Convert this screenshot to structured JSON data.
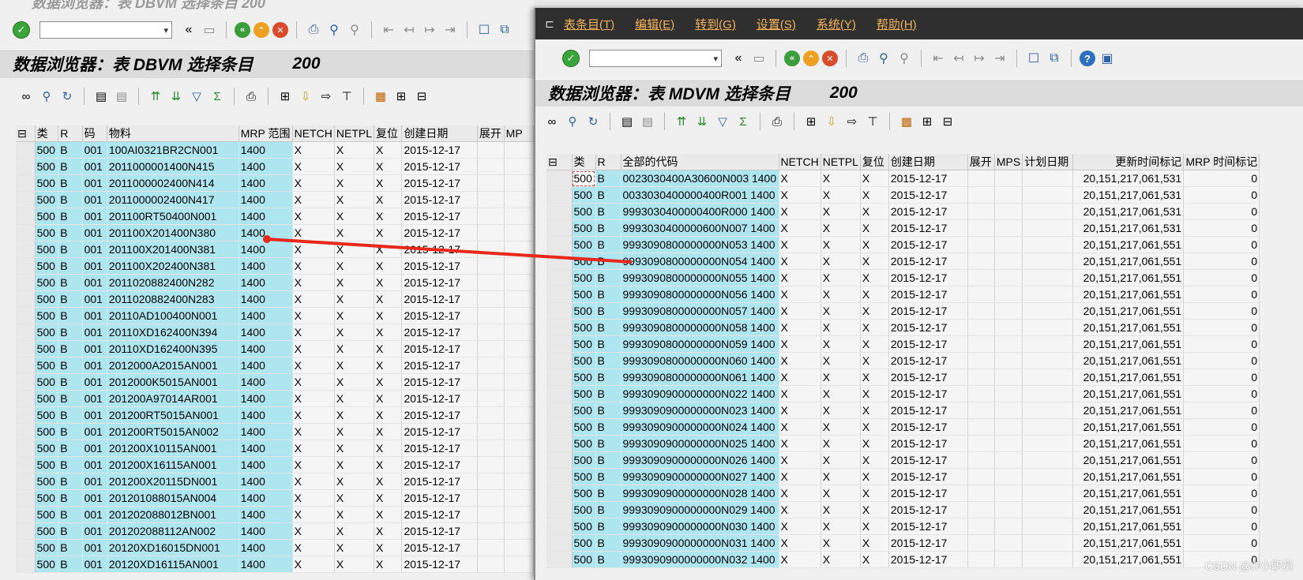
{
  "left": {
    "ghost_title": "数据浏览器：表 DBVM 选择条目     200",
    "title": "数据浏览器：表 DBVM 选择条目",
    "count": "200",
    "columns": [
      "类",
      "R",
      "码",
      "物料",
      "MRP 范围",
      "NETCH",
      "NETPL",
      "复位",
      "创建日期",
      "展开",
      "MP"
    ],
    "rows": [
      [
        "500",
        "B",
        "001",
        "100AI0321BR2CN001",
        "1400",
        "X",
        "X",
        "X",
        "2015-12-17"
      ],
      [
        "500",
        "B",
        "001",
        "2011000001400N415",
        "1400",
        "X",
        "X",
        "X",
        "2015-12-17"
      ],
      [
        "500",
        "B",
        "001",
        "2011000002400N414",
        "1400",
        "X",
        "X",
        "X",
        "2015-12-17"
      ],
      [
        "500",
        "B",
        "001",
        "2011000002400N417",
        "1400",
        "X",
        "X",
        "X",
        "2015-12-17"
      ],
      [
        "500",
        "B",
        "001",
        "201100RT50400N001",
        "1400",
        "X",
        "X",
        "X",
        "2015-12-17"
      ],
      [
        "500",
        "B",
        "001",
        "201100X201400N380",
        "1400",
        "X",
        "X",
        "X",
        "2015-12-17"
      ],
      [
        "500",
        "B",
        "001",
        "201100X201400N381",
        "1400",
        "X",
        "X",
        "X",
        "2015-12-17"
      ],
      [
        "500",
        "B",
        "001",
        "201100X202400N381",
        "1400",
        "X",
        "X",
        "X",
        "2015-12-17"
      ],
      [
        "500",
        "B",
        "001",
        "2011020882400N282",
        "1400",
        "X",
        "X",
        "X",
        "2015-12-17"
      ],
      [
        "500",
        "B",
        "001",
        "2011020882400N283",
        "1400",
        "X",
        "X",
        "X",
        "2015-12-17"
      ],
      [
        "500",
        "B",
        "001",
        "20110AD100400N001",
        "1400",
        "X",
        "X",
        "X",
        "2015-12-17"
      ],
      [
        "500",
        "B",
        "001",
        "20110XD162400N394",
        "1400",
        "X",
        "X",
        "X",
        "2015-12-17"
      ],
      [
        "500",
        "B",
        "001",
        "20110XD162400N395",
        "1400",
        "X",
        "X",
        "X",
        "2015-12-17"
      ],
      [
        "500",
        "B",
        "001",
        "2012000A2015AN001",
        "1400",
        "X",
        "X",
        "X",
        "2015-12-17"
      ],
      [
        "500",
        "B",
        "001",
        "2012000K5015AN001",
        "1400",
        "X",
        "X",
        "X",
        "2015-12-17"
      ],
      [
        "500",
        "B",
        "001",
        "201200A97014AR001",
        "1400",
        "X",
        "X",
        "X",
        "2015-12-17"
      ],
      [
        "500",
        "B",
        "001",
        "201200RT5015AN001",
        "1400",
        "X",
        "X",
        "X",
        "2015-12-17"
      ],
      [
        "500",
        "B",
        "001",
        "201200RT5015AN002",
        "1400",
        "X",
        "X",
        "X",
        "2015-12-17"
      ],
      [
        "500",
        "B",
        "001",
        "201200X10115AN001",
        "1400",
        "X",
        "X",
        "X",
        "2015-12-17"
      ],
      [
        "500",
        "B",
        "001",
        "201200X16115AN001",
        "1400",
        "X",
        "X",
        "X",
        "2015-12-17"
      ],
      [
        "500",
        "B",
        "001",
        "201200X20115DN001",
        "1400",
        "X",
        "X",
        "X",
        "2015-12-17"
      ],
      [
        "500",
        "B",
        "001",
        "201201088015AN004",
        "1400",
        "X",
        "X",
        "X",
        "2015-12-17"
      ],
      [
        "500",
        "B",
        "001",
        "201202088012BN001",
        "1400",
        "X",
        "X",
        "X",
        "2015-12-17"
      ],
      [
        "500",
        "B",
        "001",
        "201202088112AN002",
        "1400",
        "X",
        "X",
        "X",
        "2015-12-17"
      ],
      [
        "500",
        "B",
        "001",
        "20120XD16015DN001",
        "1400",
        "X",
        "X",
        "X",
        "2015-12-17"
      ],
      [
        "500",
        "B",
        "001",
        "20120XD16115AN001",
        "1400",
        "X",
        "X",
        "X",
        "2015-12-17"
      ]
    ]
  },
  "right": {
    "menu": [
      "表条目(T)",
      "编辑(E)",
      "转到(G)",
      "设置(S)",
      "系统(Y)",
      "帮助(H)"
    ],
    "title": "数据浏览器：表 MDVM 选择条目",
    "count": "200",
    "columns": [
      "类",
      "R",
      "全部的代码",
      "NETCH",
      "NETPL",
      "复位",
      "创建日期",
      "展开",
      "MPS",
      "计划日期",
      "更新时间标记",
      "MRP 时间标记"
    ],
    "rows": [
      [
        "500",
        "B",
        "0023030400A30600N003 1400",
        "X",
        "X",
        "X",
        "2015-12-17",
        "",
        "",
        "",
        "20,151,217,061,531",
        "0"
      ],
      [
        "500",
        "B",
        "0033030400000400R001 1400",
        "X",
        "X",
        "X",
        "2015-12-17",
        "",
        "",
        "",
        "20,151,217,061,531",
        "0"
      ],
      [
        "500",
        "B",
        "9993030400000400R000 1400",
        "X",
        "X",
        "X",
        "2015-12-17",
        "",
        "",
        "",
        "20,151,217,061,531",
        "0"
      ],
      [
        "500",
        "B",
        "9993030400000600N007 1400",
        "X",
        "X",
        "X",
        "2015-12-17",
        "",
        "",
        "",
        "20,151,217,061,531",
        "0"
      ],
      [
        "500",
        "B",
        "9993090800000000N053 1400",
        "X",
        "X",
        "X",
        "2015-12-17",
        "",
        "",
        "",
        "20,151,217,061,551",
        "0"
      ],
      [
        "500",
        "B",
        "9993090800000000N054 1400",
        "X",
        "X",
        "X",
        "2015-12-17",
        "",
        "",
        "",
        "20,151,217,061,551",
        "0"
      ],
      [
        "500",
        "B",
        "9993090800000000N055 1400",
        "X",
        "X",
        "X",
        "2015-12-17",
        "",
        "",
        "",
        "20,151,217,061,551",
        "0"
      ],
      [
        "500",
        "B",
        "9993090800000000N056 1400",
        "X",
        "X",
        "X",
        "2015-12-17",
        "",
        "",
        "",
        "20,151,217,061,551",
        "0"
      ],
      [
        "500",
        "B",
        "9993090800000000N057 1400",
        "X",
        "X",
        "X",
        "2015-12-17",
        "",
        "",
        "",
        "20,151,217,061,551",
        "0"
      ],
      [
        "500",
        "B",
        "9993090800000000N058 1400",
        "X",
        "X",
        "X",
        "2015-12-17",
        "",
        "",
        "",
        "20,151,217,061,551",
        "0"
      ],
      [
        "500",
        "B",
        "9993090800000000N059 1400",
        "X",
        "X",
        "X",
        "2015-12-17",
        "",
        "",
        "",
        "20,151,217,061,551",
        "0"
      ],
      [
        "500",
        "B",
        "9993090800000000N060 1400",
        "X",
        "X",
        "X",
        "2015-12-17",
        "",
        "",
        "",
        "20,151,217,061,551",
        "0"
      ],
      [
        "500",
        "B",
        "9993090800000000N061 1400",
        "X",
        "X",
        "X",
        "2015-12-17",
        "",
        "",
        "",
        "20,151,217,061,551",
        "0"
      ],
      [
        "500",
        "B",
        "9993090900000000N022 1400",
        "X",
        "X",
        "X",
        "2015-12-17",
        "",
        "",
        "",
        "20,151,217,061,551",
        "0"
      ],
      [
        "500",
        "B",
        "9993090900000000N023 1400",
        "X",
        "X",
        "X",
        "2015-12-17",
        "",
        "",
        "",
        "20,151,217,061,551",
        "0"
      ],
      [
        "500",
        "B",
        "9993090900000000N024 1400",
        "X",
        "X",
        "X",
        "2015-12-17",
        "",
        "",
        "",
        "20,151,217,061,551",
        "0"
      ],
      [
        "500",
        "B",
        "9993090900000000N025 1400",
        "X",
        "X",
        "X",
        "2015-12-17",
        "",
        "",
        "",
        "20,151,217,061,551",
        "0"
      ],
      [
        "500",
        "B",
        "9993090900000000N026 1400",
        "X",
        "X",
        "X",
        "2015-12-17",
        "",
        "",
        "",
        "20,151,217,061,551",
        "0"
      ],
      [
        "500",
        "B",
        "9993090900000000N027 1400",
        "X",
        "X",
        "X",
        "2015-12-17",
        "",
        "",
        "",
        "20,151,217,061,551",
        "0"
      ],
      [
        "500",
        "B",
        "9993090900000000N028 1400",
        "X",
        "X",
        "X",
        "2015-12-17",
        "",
        "",
        "",
        "20,151,217,061,551",
        "0"
      ],
      [
        "500",
        "B",
        "9993090900000000N029 1400",
        "X",
        "X",
        "X",
        "2015-12-17",
        "",
        "",
        "",
        "20,151,217,061,551",
        "0"
      ],
      [
        "500",
        "B",
        "9993090900000000N030 1400",
        "X",
        "X",
        "X",
        "2015-12-17",
        "",
        "",
        "",
        "20,151,217,061,551",
        "0"
      ],
      [
        "500",
        "B",
        "9993090900000000N031 1400",
        "X",
        "X",
        "X",
        "2015-12-17",
        "",
        "",
        "",
        "20,151,217,061,551",
        "0"
      ],
      [
        "500",
        "B",
        "9993090900000000N032 1400",
        "X",
        "X",
        "X",
        "2015-12-17",
        "",
        "",
        "",
        "20,151,217,061,551",
        "0"
      ]
    ]
  },
  "annotation_arrow_color": "#e8281c",
  "watermark": "CSDN @IT小职员",
  "icons": [
    "check-icon",
    "back-icon",
    "save-icon",
    "back-green-icon",
    "exit-orange-icon",
    "cancel-red-icon",
    "print-icon",
    "find-icon",
    "find-next-icon",
    "first-page-icon",
    "prev-page-icon",
    "next-page-icon",
    "last-page-icon",
    "new-session-icon",
    "shortcut-icon",
    "help-icon",
    "layout-icon"
  ]
}
